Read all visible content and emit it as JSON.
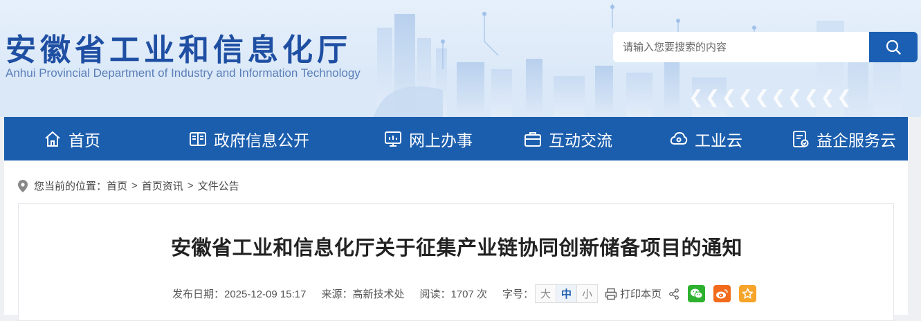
{
  "header": {
    "title_cn": "安徽省工业和信息化厅",
    "title_en": "Anhui Provincial Department of Industry and Information Technology",
    "search": {
      "placeholder": "请输入您要搜索的内容",
      "button_icon": "search-icon"
    }
  },
  "nav": {
    "items": [
      {
        "label": "首页",
        "icon": "home-icon"
      },
      {
        "label": "政府信息公开",
        "icon": "book-icon"
      },
      {
        "label": "网上办事",
        "icon": "monitor-icon"
      },
      {
        "label": "互动交流",
        "icon": "briefcase-icon"
      },
      {
        "label": "工业云",
        "icon": "cloud-icon"
      },
      {
        "label": "益企服务云",
        "icon": "document-check-icon"
      }
    ]
  },
  "breadcrumb": {
    "prefix": "您当前的位置：",
    "items": [
      "首页",
      "首页资讯",
      "文件公告"
    ],
    "separator": ">"
  },
  "article": {
    "title": "安徽省工业和信息化厅关于征集产业链协同创新储备项目的通知",
    "publish_date": "发布日期：2025-12-09 15:17",
    "source": "来源：高新技术处",
    "reads": "阅读：1707 次",
    "font_size_label": "字号：",
    "font_sizes": [
      "大",
      "中",
      "小"
    ],
    "font_size_selected": "中",
    "print_label": "打印本页"
  },
  "colors": {
    "brand_blue": "#1b5eae",
    "wechat_green": "#2db12f",
    "weibo_orange": "#f26b1d",
    "favorite_orange": "#f7a42a"
  }
}
